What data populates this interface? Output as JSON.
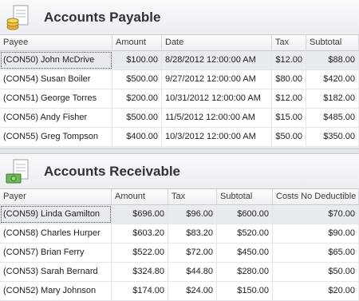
{
  "payable": {
    "title": "Accounts Payable",
    "columns": [
      "Payee",
      "Amount",
      "Date",
      "Tax",
      "Subtotal"
    ],
    "rows": [
      [
        "(CON50) John McDrive",
        "$100.00",
        "8/28/2012 12:00:00 AM",
        "$12.00",
        "$88.00"
      ],
      [
        "(CON54) Susan Boiler",
        "$500.00",
        "9/27/2012 12:00:00 AM",
        "$80.00",
        "$420.00"
      ],
      [
        "(CON51) George Torres",
        "$200.00",
        "10/31/2012 12:00:00 AM",
        "$12.00",
        "$182.00"
      ],
      [
        "(CON56) Andy Fisher",
        "$500.00",
        "11/5/2012 12:00:00 AM",
        "$15.00",
        "$485.00"
      ],
      [
        "(CON55) Greg Tompson",
        "$400.00",
        "10/3/2012 12:00:00 AM",
        "$50.00",
        "$350.00"
      ]
    ]
  },
  "receivable": {
    "title": "Accounts Receivable",
    "columns": [
      "Payer",
      "Amount",
      "Tax",
      "Subtotal",
      "Costs No Deductible"
    ],
    "rows": [
      [
        "(CON59) Linda Gamilton",
        "$696.00",
        "$96.00",
        "$600.00",
        "$70.00"
      ],
      [
        "(CON58) Charles Hurper",
        "$603.20",
        "$83.20",
        "$520.00",
        "$90.00"
      ],
      [
        "(CON57) Brian Ferry",
        "$522.00",
        "$72.00",
        "$450.00",
        "$65.00"
      ],
      [
        "(CON53) Sarah Bernard",
        "$324.80",
        "$44.80",
        "$280.00",
        "$50.00"
      ],
      [
        "(CON52) Mary Johnson",
        "$174.00",
        "$24.00",
        "$150.00",
        "$20.00"
      ]
    ]
  },
  "icons": {
    "payable": "document-coins-icon",
    "receivable": "document-money-icon"
  },
  "colors": {
    "selected_row": "#e8ecf1",
    "header_bg": "#eceef2"
  }
}
